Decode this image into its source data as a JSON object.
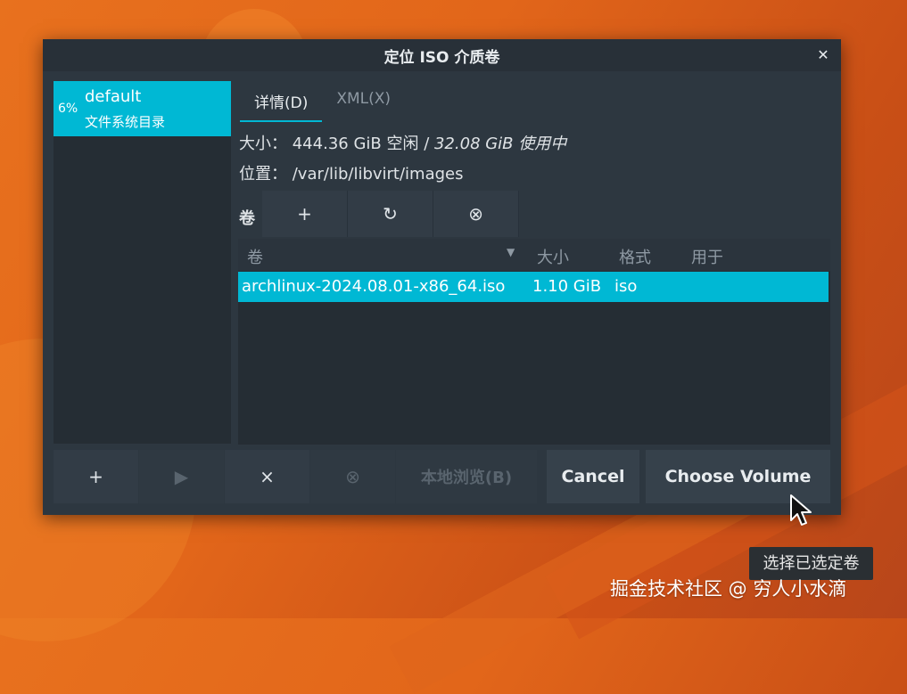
{
  "dialog": {
    "title": "定位 ISO 介质卷",
    "close_icon": "close-icon"
  },
  "pool": {
    "usage": "6%",
    "name": "default",
    "type": "文件系统目录"
  },
  "tabs": [
    {
      "label": "详情(D)",
      "active": true
    },
    {
      "label": "XML(X)",
      "active": false
    }
  ],
  "details": {
    "size_label": "大小：",
    "size_free": "444.36 GiB 空闲",
    "size_sep": " / ",
    "size_used": "32.08 GiB 使用中",
    "location_label": "位置：",
    "location_value": "/var/lib/libvirt/images",
    "volumes_label": "卷"
  },
  "volume_toolbar": {
    "add": "+",
    "refresh": "↻",
    "delete": "⊗"
  },
  "table": {
    "columns": [
      "卷",
      "大小",
      "格式",
      "用于"
    ],
    "rows": [
      {
        "volume": "archlinux-2024.08.01-x86_64.iso",
        "size": "1.10 GiB",
        "format": "iso",
        "used_by": ""
      }
    ]
  },
  "bottom": {
    "add": "+",
    "start": "▶",
    "stop": "×",
    "delete": "⊗",
    "browse": "本地浏览(B)",
    "cancel": "Cancel",
    "choose": "Choose Volume"
  },
  "tooltip": "选择已选定卷",
  "watermark": "掘金技术社区 @ 穷人小水滴",
  "colors": {
    "accent": "#00b8d4",
    "dialog_bg": "#2d3740"
  }
}
